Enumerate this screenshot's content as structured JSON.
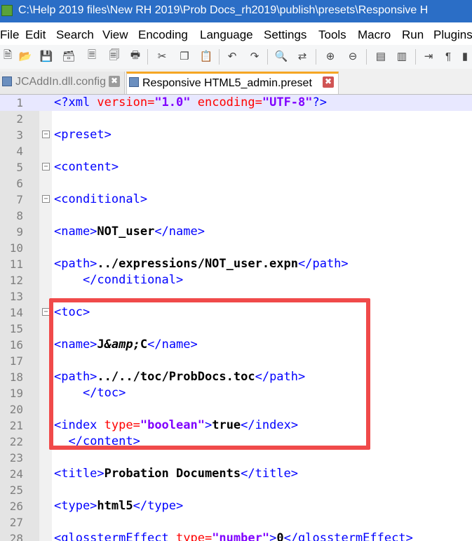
{
  "window": {
    "title": "C:\\Help 2019 files\\New RH 2019\\Prob Docs_rh2019\\publish\\presets\\Responsive H"
  },
  "menu": [
    "File",
    "Edit",
    "Search",
    "View",
    "Encoding",
    "Language",
    "Settings",
    "Tools",
    "Macro",
    "Run",
    "Plugins"
  ],
  "toolbar_icons": [
    "new-file-icon",
    "open-file-icon",
    "save-icon",
    "save-all-icon",
    "close-icon",
    "close-all-icon",
    "print-icon",
    "cut-icon",
    "copy-icon",
    "paste-icon",
    "undo-icon",
    "redo-icon",
    "find-icon",
    "replace-icon",
    "zoom-in-icon",
    "zoom-out-icon",
    "sync-vertical-icon",
    "sync-horizontal-icon",
    "word-wrap-icon",
    "show-all-chars-icon",
    "indent-guide-icon"
  ],
  "tabs": [
    {
      "label": "JCAddIn.dll.config",
      "active": false
    },
    {
      "label": "Responsive HTML5_admin.preset",
      "active": true
    }
  ],
  "editor": {
    "current_line": 1,
    "lines": [
      {
        "num": "1",
        "segments": [
          "<?xml ",
          "version=",
          "\"1.0\"",
          " encoding=",
          "\"UTF-8\"",
          "?>"
        ]
      },
      {
        "num": "2",
        "segments": []
      },
      {
        "num": "3",
        "segments": [
          "<preset>"
        ]
      },
      {
        "num": "4",
        "segments": []
      },
      {
        "num": "5",
        "segments": [
          "<content>"
        ]
      },
      {
        "num": "6",
        "segments": []
      },
      {
        "num": "7",
        "segments": [
          "<conditional>"
        ]
      },
      {
        "num": "8",
        "segments": []
      },
      {
        "num": "9",
        "segments": [
          "<name>",
          "NOT_user",
          "</name>"
        ]
      },
      {
        "num": "10",
        "segments": []
      },
      {
        "num": "11",
        "segments": [
          "<path>",
          "../expressions/NOT_user.expn",
          "</path>"
        ]
      },
      {
        "num": "12",
        "segments": [
          "    ",
          "</conditional>"
        ]
      },
      {
        "num": "13",
        "segments": []
      },
      {
        "num": "14",
        "segments": [
          "<toc>"
        ]
      },
      {
        "num": "15",
        "segments": []
      },
      {
        "num": "16",
        "segments": [
          "<name>",
          "J",
          "&amp;",
          "C",
          "</name>"
        ]
      },
      {
        "num": "17",
        "segments": []
      },
      {
        "num": "18",
        "segments": [
          "<path>",
          "../../toc/ProbDocs.toc",
          "</path>"
        ]
      },
      {
        "num": "19",
        "segments": [
          "    ",
          "</toc>"
        ]
      },
      {
        "num": "20",
        "segments": []
      },
      {
        "num": "21",
        "segments": [
          "<index ",
          "type=",
          "\"boolean\"",
          ">",
          "true",
          "</index>"
        ]
      },
      {
        "num": "22",
        "segments": [
          "  ",
          "</content>"
        ]
      },
      {
        "num": "23",
        "segments": []
      },
      {
        "num": "24",
        "segments": [
          "<title>",
          "Probation Documents",
          "</title>"
        ]
      },
      {
        "num": "25",
        "segments": []
      },
      {
        "num": "26",
        "segments": [
          "<type>",
          "html5",
          "</type>"
        ]
      },
      {
        "num": "27",
        "segments": []
      },
      {
        "num": "28",
        "segments": [
          "<glosstermEffect ",
          "type=",
          "\"number\"",
          ">",
          "0",
          "</glosstermEffect>"
        ]
      }
    ]
  },
  "annotation": {
    "color": "#f04a4a"
  }
}
